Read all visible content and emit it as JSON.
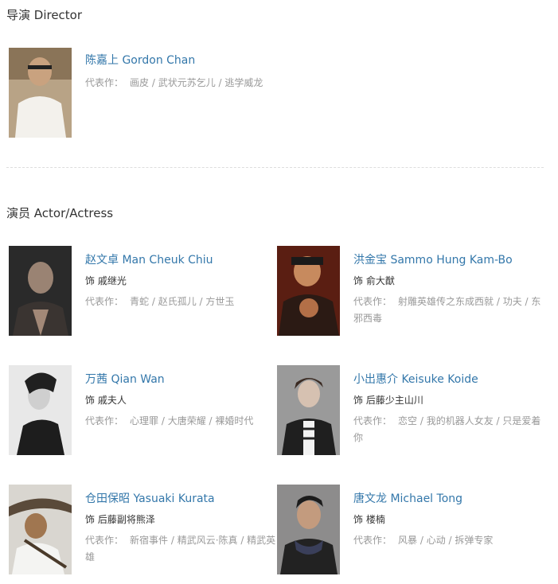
{
  "sections": {
    "director_title": "导演 Director",
    "cast_title": "演员 Actor/Actress"
  },
  "works_label": "代表作：",
  "director": {
    "name": "陈嘉上 Gordon Chan",
    "works": "画皮 / 武状元苏乞儿 / 逃学威龙"
  },
  "cast": [
    {
      "name": "赵文卓 Man Cheuk Chiu",
      "role": "饰 戚继光",
      "works": "青蛇 / 赵氏孤儿 / 方世玉"
    },
    {
      "name": "洪金宝 Sammo Hung Kam-Bo",
      "role": "饰 俞大猷",
      "works": "射雕英雄传之东成西就 / 功夫 / 东邪西毒"
    },
    {
      "name": "万茜 Qian Wan",
      "role": "饰 戚夫人",
      "works": "心理罪 / 大唐荣耀 / 裸婚时代"
    },
    {
      "name": "小出惠介 Keisuke Koide",
      "role": "饰 后藤少主山川",
      "works": "恋空 / 我的机器人女友 / 只是爱着你"
    },
    {
      "name": "仓田保昭 Yasuaki Kurata",
      "role": "饰 后藤副将熊泽",
      "works": "新宿事件 / 精武风云·陈真 / 精武英雄"
    },
    {
      "name": "唐文龙 Michael Tong",
      "role": "饰 楼楠",
      "works": "风暴 / 心动 / 拆弹专家"
    }
  ]
}
